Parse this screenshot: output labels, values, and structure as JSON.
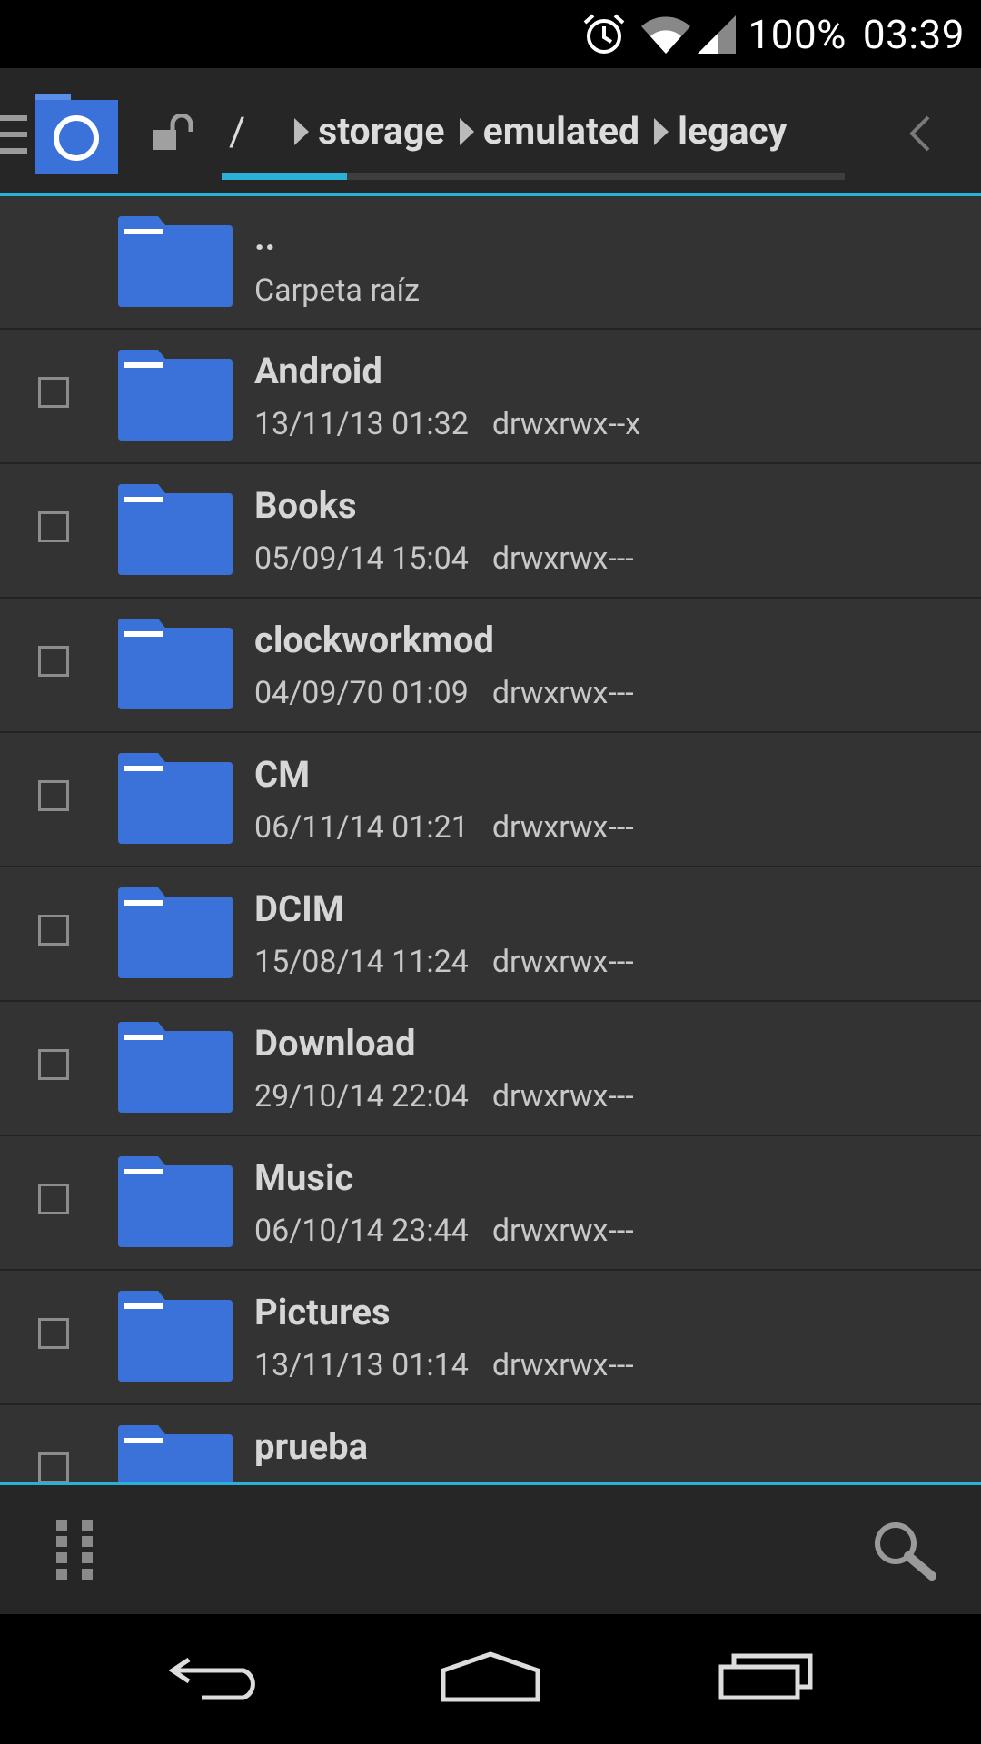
{
  "status_bar": {
    "battery": "100%",
    "time": "03:39",
    "icons": [
      "alarm-icon",
      "wifi-icon",
      "signal-icon"
    ]
  },
  "toolbar": {
    "icons": [
      "menu-icon",
      "app-logo-icon",
      "unlock-icon",
      "chevron-left-icon"
    ],
    "breadcrumb": [
      "/",
      "storage",
      "emulated",
      "legacy"
    ],
    "accent_color": "#2bb1d8"
  },
  "file_list": {
    "parent": {
      "name": "..",
      "subtitle": "Carpeta raíz"
    },
    "items": [
      {
        "name": "Android",
        "date": "13/11/13 01:32",
        "perm": "drwxrwx--x"
      },
      {
        "name": "Books",
        "date": "05/09/14 15:04",
        "perm": "drwxrwx---"
      },
      {
        "name": "clockworkmod",
        "date": "04/09/70 01:09",
        "perm": "drwxrwx---"
      },
      {
        "name": "CM",
        "date": "06/11/14 01:21",
        "perm": "drwxrwx---"
      },
      {
        "name": "DCIM",
        "date": "15/08/14 11:24",
        "perm": "drwxrwx---"
      },
      {
        "name": "Download",
        "date": "29/10/14 22:04",
        "perm": "drwxrwx---"
      },
      {
        "name": "Music",
        "date": "06/10/14 23:44",
        "perm": "drwxrwx---"
      },
      {
        "name": "Pictures",
        "date": "13/11/13 01:14",
        "perm": "drwxrwx---"
      },
      {
        "name": "prueba",
        "date": "",
        "perm": ""
      }
    ],
    "folder_color": "#3b72d9"
  },
  "bottom_bar": {
    "icons": [
      "grip-icon",
      "search-icon"
    ]
  },
  "nav_bar": {
    "icons": [
      "back-icon",
      "home-icon",
      "recents-icon"
    ]
  }
}
